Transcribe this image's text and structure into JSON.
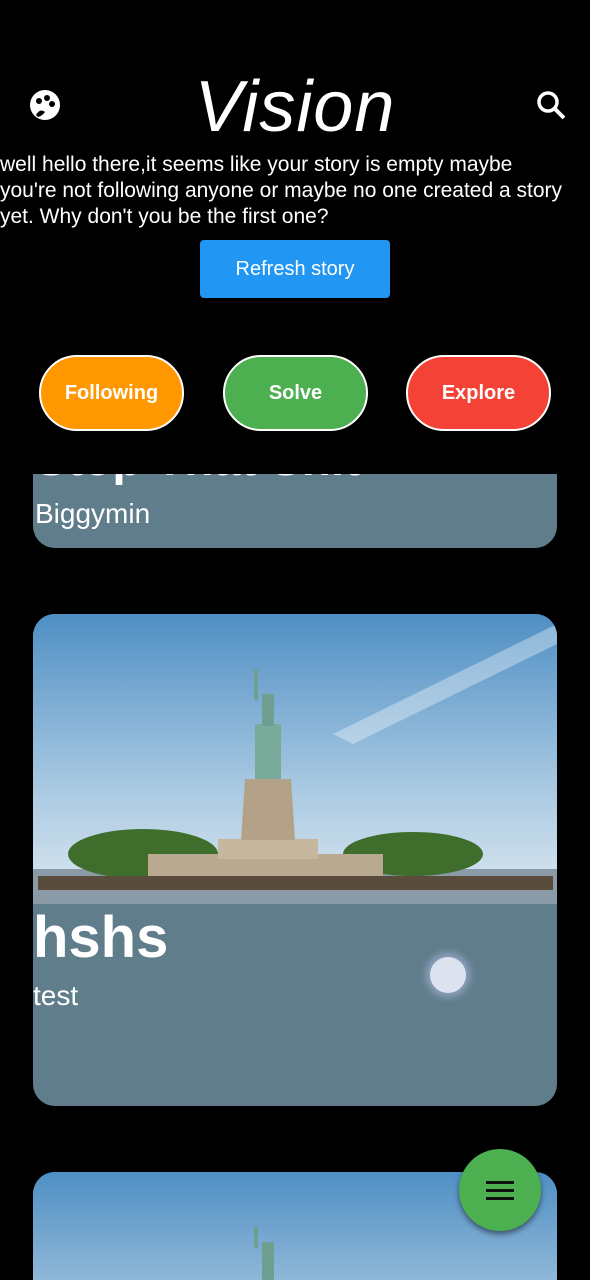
{
  "header": {
    "title": "Vision",
    "left_icon": "palette-icon",
    "right_icon": "search-icon"
  },
  "story": {
    "empty_message": "well hello there,it seems like your story is empty maybe you're not following anyone or maybe no one created a story yet. Why don't you be the first one?",
    "refresh_label": "Refresh story"
  },
  "filters": [
    {
      "label": "Following",
      "color": "#ff9800"
    },
    {
      "label": "Solve",
      "color": "#4caf50"
    },
    {
      "label": "Explore",
      "color": "#f44336"
    }
  ],
  "posts": [
    {
      "title": "Stop That Shit",
      "author": "Biggymin"
    },
    {
      "title": "hshs",
      "author": "test"
    }
  ],
  "fab": {
    "icon": "menu-icon"
  }
}
